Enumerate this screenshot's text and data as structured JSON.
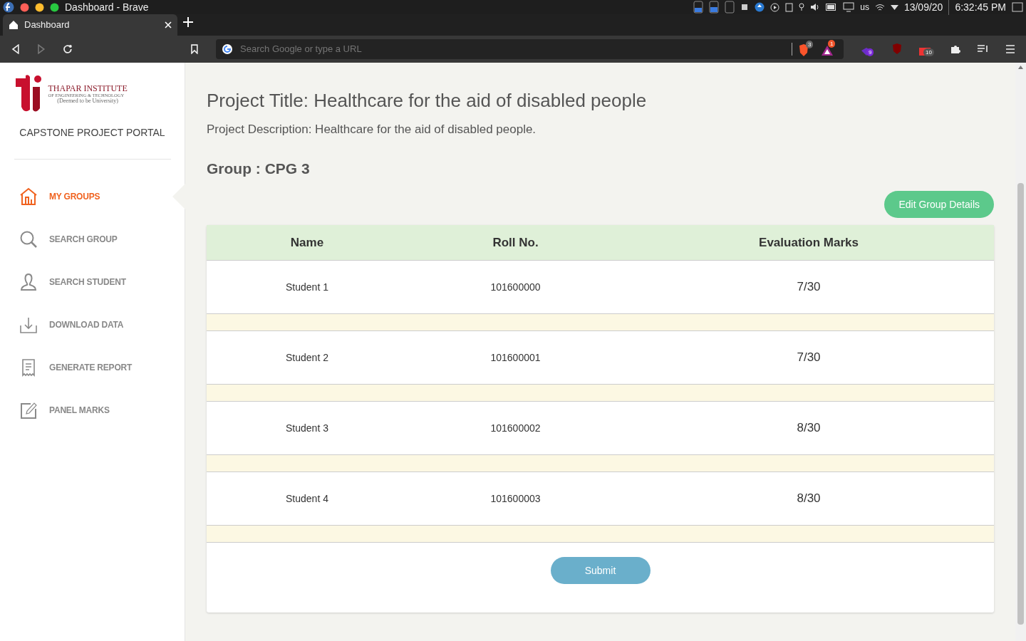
{
  "os_bar": {
    "title": "Dashboard - Brave",
    "keyboard": "us",
    "date": "13/09/20",
    "time": "6:32:45 PM"
  },
  "browser": {
    "tab": {
      "title": "Dashboard",
      "selected": true
    },
    "address": {
      "placeholder": "Search Google or type a URL"
    },
    "shields_count": "3",
    "rewards_count": "1",
    "extension_badges": [
      "9",
      "10"
    ]
  },
  "sidebar": {
    "logo": {
      "name": "THAPAR INSTITUTE",
      "line_2": "OF ENGINEERING & TECHNOLOGY",
      "line_3": "(Deemed to be University)"
    },
    "portal_title": "CAPSTONE PROJECT PORTAL",
    "items": [
      {
        "label": "MY GROUPS",
        "kind": "home",
        "selected": true
      },
      {
        "label": "SEARCH GROUP",
        "kind": "search",
        "selected": false
      },
      {
        "label": "SEARCH STUDENT",
        "kind": "person",
        "selected": false
      },
      {
        "label": "DOWNLOAD DATA",
        "kind": "download",
        "selected": false
      },
      {
        "label": "GENERATE REPORT",
        "kind": "report",
        "selected": false
      },
      {
        "label": "PANEL MARKS",
        "kind": "edit",
        "selected": false
      }
    ]
  },
  "main": {
    "project_title": "Project Title: Healthcare for the aid of disabled people",
    "project_description": "Project Description: Healthcare for the aid of disabled people.",
    "group": "Group : CPG 3",
    "edit_button": "Edit Group Details",
    "table": {
      "columns": [
        "Name",
        "Roll No.",
        "Evaluation Marks"
      ],
      "rows": [
        {
          "name": "Student 1",
          "roll_no": "101600000",
          "marks": "7/30"
        },
        {
          "name": "Student 2",
          "roll_no": "101600001",
          "marks": "7/30"
        },
        {
          "name": "Student 3",
          "roll_no": "101600002",
          "marks": "8/30"
        },
        {
          "name": "Student 4",
          "roll_no": "101600003",
          "marks": "8/30"
        }
      ]
    },
    "submit_button": "Submit"
  }
}
